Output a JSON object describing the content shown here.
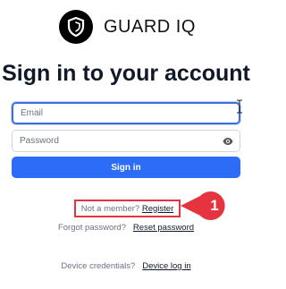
{
  "brand": {
    "name": "GUARD IQ",
    "logo_icon": "shield-icon",
    "logo_bg": "#000000"
  },
  "page": {
    "title": "Sign in to your account"
  },
  "form": {
    "email": {
      "value": "",
      "placeholder": "Email"
    },
    "password": {
      "value": "",
      "placeholder": "Password",
      "toggle_icon": "eye-icon"
    },
    "submit_label": "Sign in",
    "accent_color": "#2d6cf6"
  },
  "links": {
    "register_prompt": "Not a member?",
    "register_link": "Register",
    "forgot_prompt": "Forgot password?",
    "forgot_link": "Reset password",
    "device_prompt": "Device credentials?",
    "device_link": "Device log in"
  },
  "annotation": {
    "marker_number": "1",
    "highlight_color": "#e5343f"
  }
}
